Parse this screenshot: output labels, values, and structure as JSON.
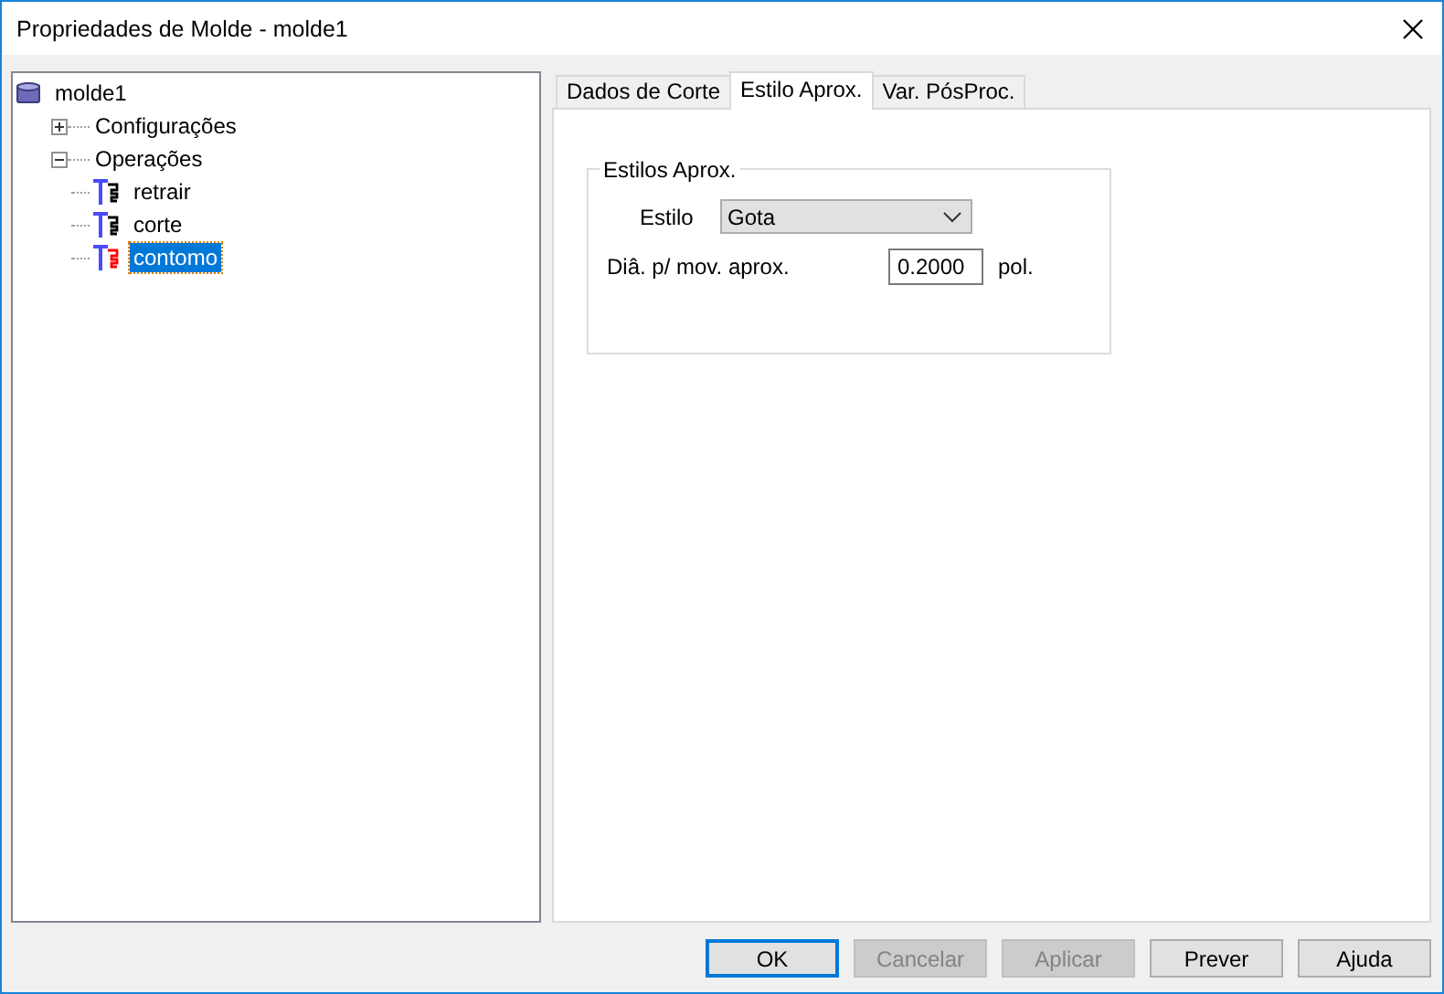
{
  "window": {
    "title": "Propriedades de Molde - molde1"
  },
  "tree": {
    "label": "molde1",
    "kind": "database",
    "children": [
      {
        "label": "Configurações",
        "expanded": false,
        "selected": false
      },
      {
        "label": "Operações",
        "expanded": true,
        "selected": false,
        "children": [
          {
            "label": "retrair",
            "kind": "operation",
            "color": "#000000",
            "selected": false
          },
          {
            "label": "corte",
            "kind": "operation",
            "color": "#000000",
            "selected": false
          },
          {
            "label": "contomo",
            "kind": "operation",
            "color": "#ff0000",
            "selected": true
          }
        ]
      }
    ]
  },
  "tabs": [
    {
      "label": "Dados de Corte",
      "selected": false
    },
    {
      "label": "Estilo Aprox.",
      "selected": true
    },
    {
      "label": "Var. PósProc.",
      "selected": false
    }
  ],
  "group": {
    "title": "Estilos Aprox.",
    "style_label": "Estilo",
    "style_value": "Gota",
    "diameter_label": "Diâ. p/ mov. aprox.",
    "diameter_value": "0.2000",
    "unit": "pol."
  },
  "buttons": [
    {
      "label": "OK",
      "disabled": false,
      "default": true
    },
    {
      "label": "Cancelar",
      "disabled": true,
      "default": false
    },
    {
      "label": "Aplicar",
      "disabled": true,
      "default": false
    },
    {
      "label": "Prever",
      "disabled": false,
      "default": false
    },
    {
      "label": "Ajuda",
      "disabled": false,
      "default": false
    }
  ]
}
